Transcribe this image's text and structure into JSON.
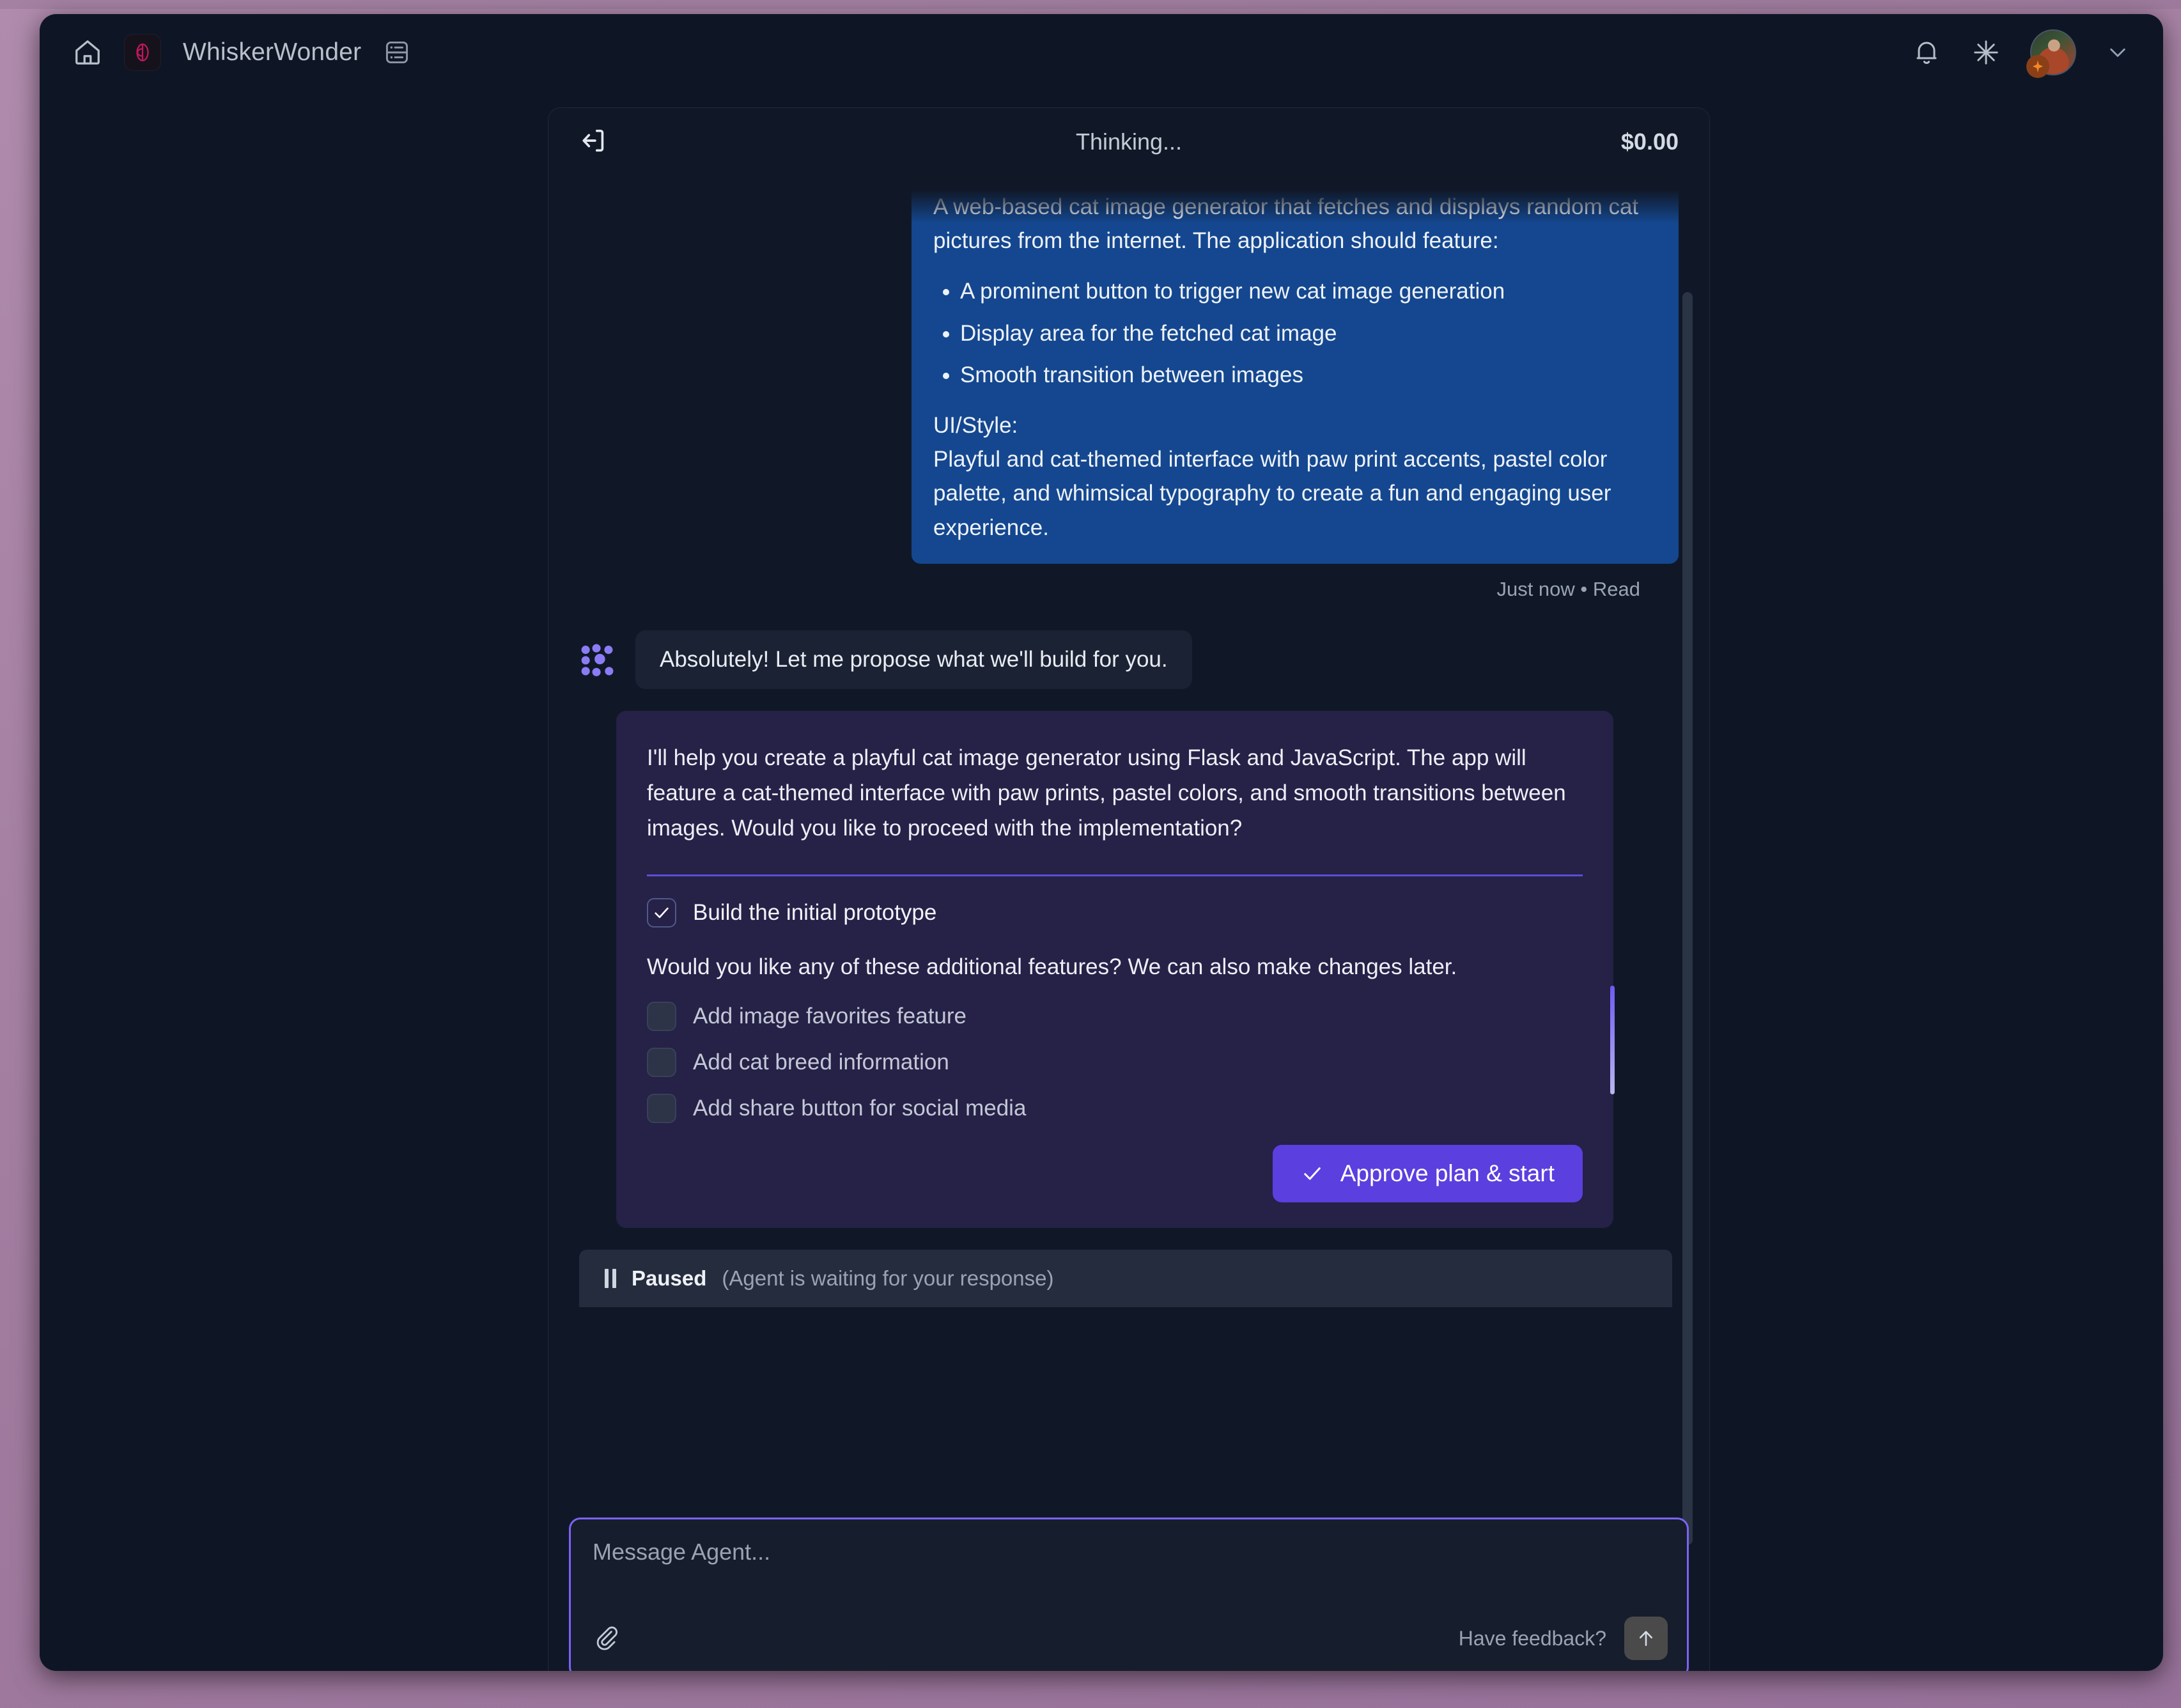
{
  "topbar": {
    "home_icon": "home-icon",
    "project_icon": "cat-logo-icon",
    "project_title": "WhiskerWonder",
    "panel_icon": "panel-layout-icon",
    "bell_icon": "bell-icon",
    "sparkle_icon": "sparkle-icon",
    "avatar_icon": "user-avatar",
    "avatar_badge_icon": "sparkle-badge-icon",
    "chevron_icon": "chevron-down-icon"
  },
  "pane": {
    "exit_icon": "exit-arrow-icon",
    "title": "Thinking...",
    "cost": "$0.00"
  },
  "user_message": {
    "intro": "A web-based cat image generator that fetches and displays random cat pictures from the internet. The application should feature:",
    "bullets": [
      "A prominent button to trigger new cat image generation",
      "Display area for the fetched cat image",
      "Smooth transition between images"
    ],
    "style_label": "UI/Style:",
    "style_text": "Playful and cat-themed interface with paw print accents, pastel color palette, and whimsical typography to create a fun and engaging user experience.",
    "meta": "Just now • Read"
  },
  "assistant_message": {
    "avatar_icon": "agent-dots-icon",
    "text": "Absolutely! Let me propose what we'll build for you."
  },
  "plan": {
    "intro": "I'll help you create a playful cat image generator using Flask and JavaScript. The app will feature a cat-themed interface with paw prints, pastel colors, and smooth transitions between images. Would you like to proceed with the implementation?",
    "primary_task": {
      "label": "Build the initial prototype",
      "checked": true,
      "check_icon": "checkmark-icon"
    },
    "question": "Would you like any of these additional features? We can also make changes later.",
    "options": [
      {
        "label": "Add image favorites feature",
        "checked": false
      },
      {
        "label": "Add cat breed information",
        "checked": false
      },
      {
        "label": "Add share button for social media",
        "checked": false
      }
    ],
    "approve_button": {
      "label": "Approve plan & start",
      "icon": "checkmark-icon"
    },
    "accent_color": "#6d5bf0"
  },
  "status": {
    "pause_icon": "pause-icon",
    "label": "Paused",
    "detail": "(Agent is waiting for your response)"
  },
  "composer": {
    "placeholder": "Message Agent...",
    "value": "",
    "attach_icon": "paperclip-icon",
    "feedback_label": "Have feedback?",
    "send_icon": "arrow-up-icon"
  },
  "colors": {
    "desktop": "#a27ba0",
    "window": "#0e1625",
    "pane": "#101827",
    "user_bubble": "#14478f",
    "plan_card": "#262147",
    "accent_purple": "#5b3fdf",
    "composer_border": "#7c63f5"
  }
}
